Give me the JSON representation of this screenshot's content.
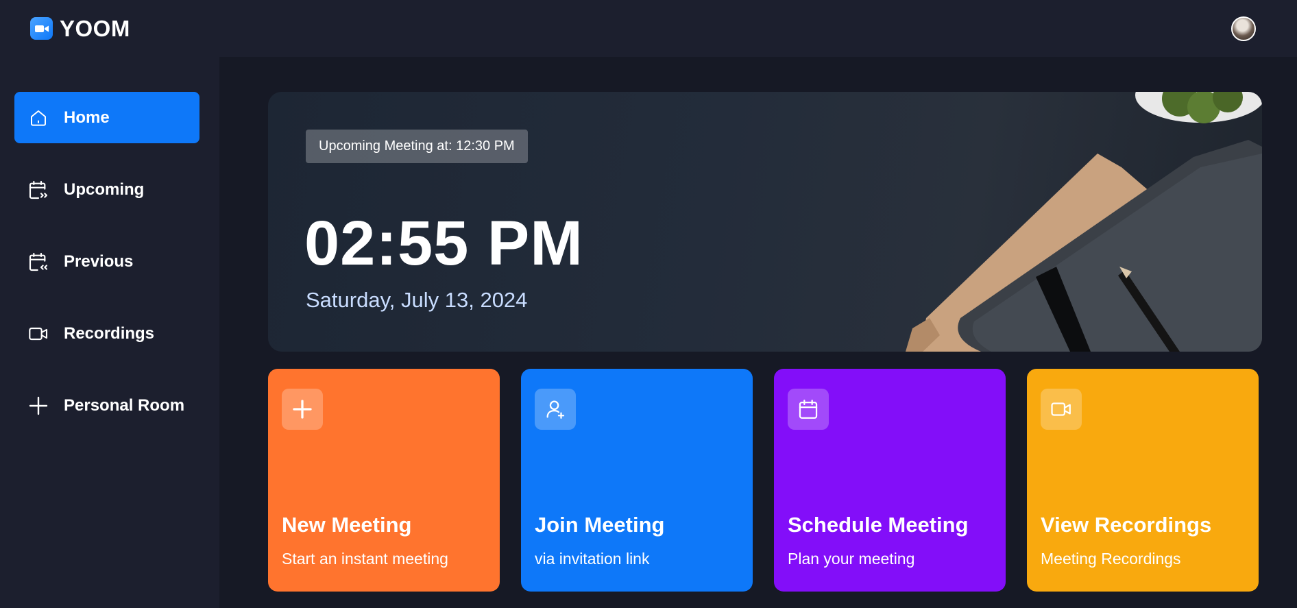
{
  "app": {
    "name": "YOOM",
    "logo_icon": "video-camera-icon",
    "accent": "#0e78f9"
  },
  "user": {
    "avatar": "user-avatar"
  },
  "sidebar": {
    "items": [
      {
        "label": "Home",
        "icon": "home-icon",
        "active": true
      },
      {
        "label": "Upcoming",
        "icon": "calendar-upcoming-icon",
        "active": false
      },
      {
        "label": "Previous",
        "icon": "calendar-previous-icon",
        "active": false
      },
      {
        "label": "Recordings",
        "icon": "video-icon",
        "active": false
      },
      {
        "label": "Personal Room",
        "icon": "plus-icon",
        "active": false
      }
    ]
  },
  "hero": {
    "badge": "Upcoming Meeting at: 12:30 PM",
    "time": "02:55 PM",
    "date": "Saturday, July 13, 2024"
  },
  "cards": [
    {
      "title": "New Meeting",
      "subtitle": "Start an instant meeting",
      "icon": "plus-icon",
      "color": "#ff742e"
    },
    {
      "title": "Join Meeting",
      "subtitle": "via invitation link",
      "icon": "add-user-icon",
      "color": "#0e78f9"
    },
    {
      "title": "Schedule Meeting",
      "subtitle": "Plan your meeting",
      "icon": "calendar-icon",
      "color": "#830ef9"
    },
    {
      "title": "View Recordings",
      "subtitle": "Meeting Recordings",
      "icon": "video-icon",
      "color": "#f9a90e"
    }
  ]
}
